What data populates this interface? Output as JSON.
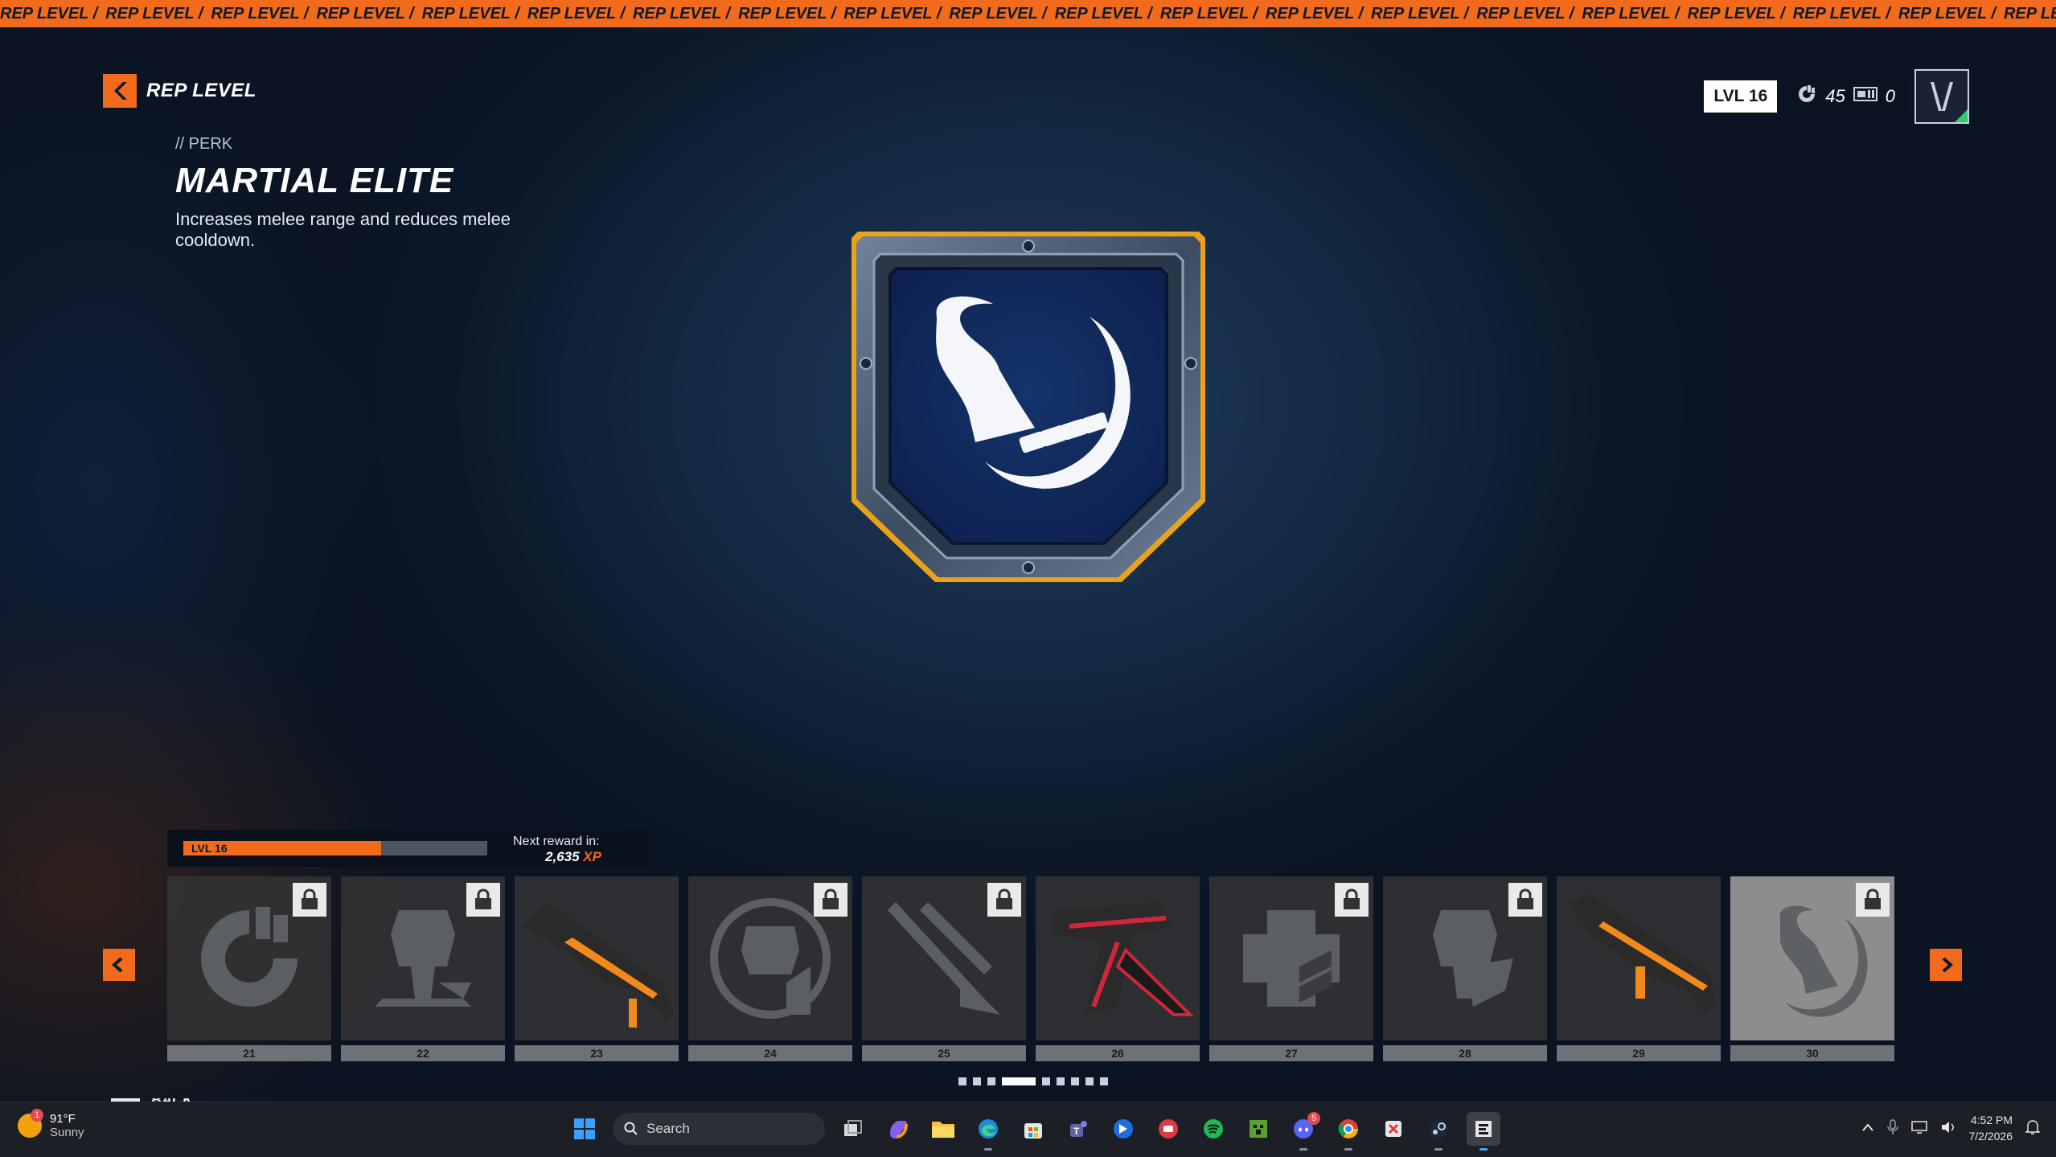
{
  "ticker": {
    "text": "REP LEVEL /"
  },
  "header": {
    "title": "REP LEVEL"
  },
  "perk": {
    "tag": "// PERK",
    "name": "MARTIAL ELITE",
    "description": "Increases melee range and reduces melee cooldown."
  },
  "hud": {
    "level": "LVL 16",
    "currency_1": "45",
    "currency_2": "0"
  },
  "progress": {
    "level_label": "LVL 16",
    "fill_fraction": 0.65,
    "next_label": "Next reward in:",
    "next_xp": "2,635",
    "xp_unit": "XP"
  },
  "rewards": [
    {
      "level": "21",
      "kind": "currency-icon",
      "locked": true
    },
    {
      "level": "22",
      "kind": "mech-drop-icon",
      "locked": true
    },
    {
      "level": "23",
      "kind": "rifle-skin",
      "locked": false
    },
    {
      "level": "24",
      "kind": "mech-armor-icon",
      "locked": true
    },
    {
      "level": "25",
      "kind": "missile-icon",
      "locked": true
    },
    {
      "level": "26",
      "kind": "pistol-skin",
      "locked": false
    },
    {
      "level": "27",
      "kind": "health-icon",
      "locked": true
    },
    {
      "level": "28",
      "kind": "mech-weapon-icon",
      "locked": true
    },
    {
      "level": "29",
      "kind": "smg-skin",
      "locked": false
    },
    {
      "level": "30",
      "kind": "melee-perk-icon",
      "locked": true,
      "selected": true
    }
  ],
  "pager": {
    "pages": 9,
    "active": 3
  },
  "footer": {
    "back_key": "Esc",
    "back_label": "BACK"
  },
  "taskbar": {
    "weather_temp": "91°F",
    "weather_desc": "Sunny",
    "weather_alert": "1",
    "search_placeholder": "Search",
    "discord_badge": "5",
    "time": "4:52 PM",
    "date": "7/2/2026"
  },
  "colors": {
    "accent": "#f26a1b",
    "background": "#0d1a2b",
    "card": "#323234"
  }
}
